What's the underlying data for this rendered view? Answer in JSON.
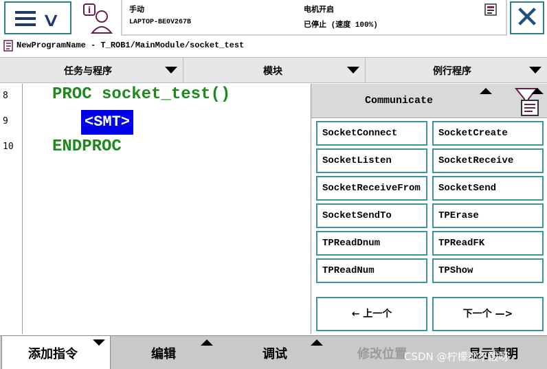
{
  "status": {
    "mode": "手动",
    "controller": "LAPTOP-BE0V267B",
    "motor_state": "电机开启",
    "run_state": "已停止 (速度 100%)"
  },
  "close_label": "✕",
  "breadcrumb": "NewProgramName - T_ROB1/MainModule/socket_test",
  "selectors": {
    "tasks": "任务与程序",
    "modules": "模块",
    "routines": "例行程序"
  },
  "editor": {
    "lines": [
      {
        "number": "8",
        "code": "PROC socket_test()"
      },
      {
        "number": "9",
        "code": "<SMT>"
      },
      {
        "number": "10",
        "code": "ENDPROC"
      }
    ]
  },
  "panel": {
    "title": "Communicate",
    "instructions": [
      "SocketConnect",
      "SocketCreate",
      "SocketListen",
      "SocketReceive",
      "SocketReceiveFrom",
      "SocketSend",
      "SocketSendTo",
      "TPErase",
      "TPReadDnum",
      "TPReadFK",
      "TPReadNum",
      "TPShow"
    ],
    "prev_label": "←  上一个",
    "next_label": "下一个  —>"
  },
  "bottom_tabs": {
    "add_instruction": "添加指令",
    "edit": "编辑",
    "debug": "调试",
    "modify_position": "修改位置",
    "show_declaration": "显示声明"
  },
  "watermark": "CSDN @柠檬都不酸呀",
  "colors": {
    "accent_border": "#3a93a0",
    "code_green": "#1e8a1e",
    "selection_blue": "#0000ee"
  }
}
